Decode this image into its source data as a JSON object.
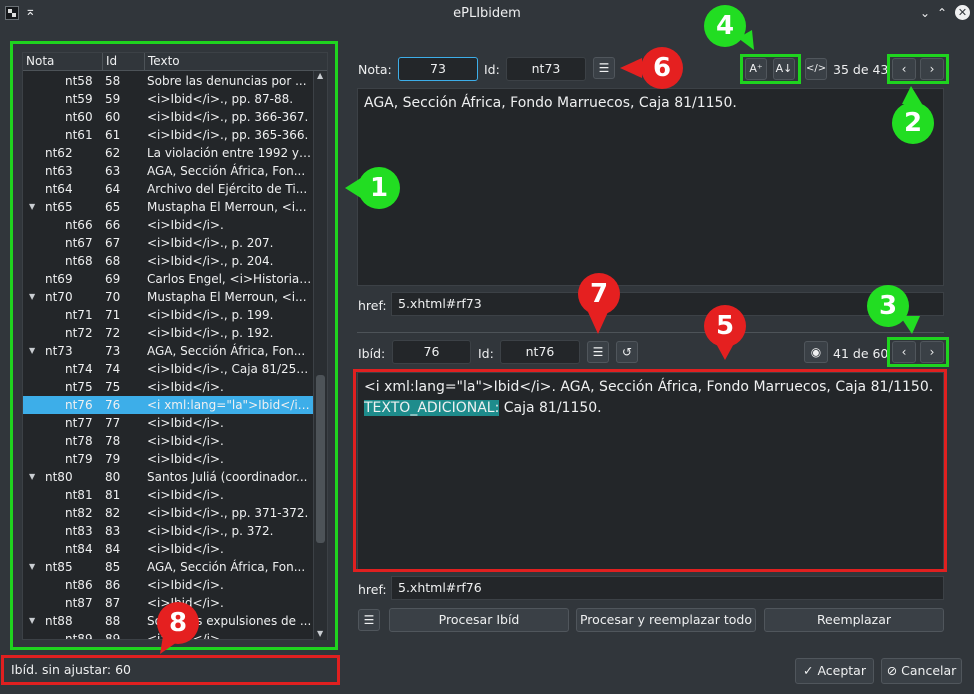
{
  "window": {
    "title": "ePLIbidem"
  },
  "tree": {
    "headers": [
      "Nota",
      "Id",
      "Texto"
    ],
    "rows": [
      {
        "nota": "nt58",
        "id": "58",
        "texto": "Sobre las denuncias por ..."
      },
      {
        "nota": "nt59",
        "id": "59",
        "texto": "<i>Ibid</i>., pp. 87-88."
      },
      {
        "nota": "nt60",
        "id": "60",
        "texto": "<i>Ibid</i>., pp. 366-367."
      },
      {
        "nota": "nt61",
        "id": "61",
        "texto": "<i>Ibid</i>., pp. 365-366."
      },
      {
        "nota": "nt62",
        "id": "62",
        "texto": "La violación entre 1992 y ..."
      },
      {
        "nota": "nt63",
        "id": "63",
        "texto": "AGA, Sección África, Fon..."
      },
      {
        "nota": "nt64",
        "id": "64",
        "texto": "Archivo del Ejército de Ti..."
      },
      {
        "nota": "nt65",
        "id": "65",
        "texto": "Mustapha El Merroun, <i..."
      },
      {
        "nota": "nt66",
        "id": "66",
        "texto": "<i>Ibid</i>."
      },
      {
        "nota": "nt67",
        "id": "67",
        "texto": "<i>Ibid</i>., p. 207."
      },
      {
        "nota": "nt68",
        "id": "68",
        "texto": "<i>Ibid</i>., p. 204."
      },
      {
        "nota": "nt69",
        "id": "69",
        "texto": "Carlos Engel, <i>Historia ..."
      },
      {
        "nota": "nt70",
        "id": "70",
        "texto": "Mustapha El Merroun, <i..."
      },
      {
        "nota": "nt71",
        "id": "71",
        "texto": "<i>Ibid</i>., p. 199."
      },
      {
        "nota": "nt72",
        "id": "72",
        "texto": "<i>Ibid</i>., p. 192."
      },
      {
        "nota": "nt73",
        "id": "73",
        "texto": "AGA, Sección África, Fon..."
      },
      {
        "nota": "nt74",
        "id": "74",
        "texto": "<i>Ibid</i>., Caja 81/2545."
      },
      {
        "nota": "nt75",
        "id": "75",
        "texto": "<i>Ibid</i>."
      },
      {
        "nota": "nt76",
        "id": "76",
        "texto": "<i xml:lang=\"la\">Ibid</i>. ..."
      },
      {
        "nota": "nt77",
        "id": "77",
        "texto": "<i>Ibid</i>."
      },
      {
        "nota": "nt78",
        "id": "78",
        "texto": "<i>Ibid</i>."
      },
      {
        "nota": "nt79",
        "id": "79",
        "texto": "<i>Ibid</i>."
      },
      {
        "nota": "nt80",
        "id": "80",
        "texto": "Santos Juliá (coordinador..."
      },
      {
        "nota": "nt81",
        "id": "81",
        "texto": "<i>Ibid</i>."
      },
      {
        "nota": "nt82",
        "id": "82",
        "texto": "<i>Ibid</i>., pp. 371-372."
      },
      {
        "nota": "nt83",
        "id": "83",
        "texto": "<i>Ibid</i>., p. 372."
      },
      {
        "nota": "nt84",
        "id": "84",
        "texto": "<i>Ibid</i>."
      },
      {
        "nota": "nt85",
        "id": "85",
        "texto": "AGA, Sección África, Fon..."
      },
      {
        "nota": "nt86",
        "id": "86",
        "texto": "<i>Ibid</i>."
      },
      {
        "nota": "nt87",
        "id": "87",
        "texto": "<i>Ibid</i>."
      },
      {
        "nota": "nt88",
        "id": "88",
        "texto": "Sobre las expulsiones de ..."
      },
      {
        "nota": "nt89",
        "id": "89",
        "texto": "<i>Ibid</i>."
      }
    ],
    "selected_nota": "nt76"
  },
  "top": {
    "nota_label": "Nota:",
    "nota_value": "73",
    "id_label": "Id:",
    "id_value": "nt73",
    "counter": "35 de 43",
    "text": "AGA, Sección África, Fondo Marruecos, Caja 81/1150.",
    "href_label": "href:",
    "href_value": "5.xhtml#rf73"
  },
  "bottom": {
    "ibid_label": "Ibíd:",
    "ibid_value": "76",
    "id_label": "Id:",
    "id_value": "nt76",
    "counter": "41 de 60",
    "text_line1": "<i xml:lang=\"la\">Ibid</i>. AGA, Sección África, Fondo Marruecos, Caja 81/1150.",
    "text_highlight": "TEXTO_ADICIONAL:",
    "text_line2_rest": " Caja 81/1150.",
    "href_label": "href:",
    "href_value": "5.xhtml#rf76",
    "btn_procesar": "Procesar Ibíd",
    "btn_procesar_todo": "Procesar y reemplazar todo",
    "btn_reemplazar": "Reemplazar"
  },
  "status": {
    "text": "Ibíd. sin ajustar: 60"
  },
  "dialog": {
    "accept": "Aceptar",
    "cancel": "Cancelar"
  },
  "annotations": [
    "1",
    "2",
    "3",
    "4",
    "5",
    "6",
    "7",
    "8"
  ],
  "colors": {
    "accent": "#3daee9",
    "annotation_green": "#22dd22",
    "annotation_red": "#e52020",
    "highlight": "#1e8c8c"
  }
}
